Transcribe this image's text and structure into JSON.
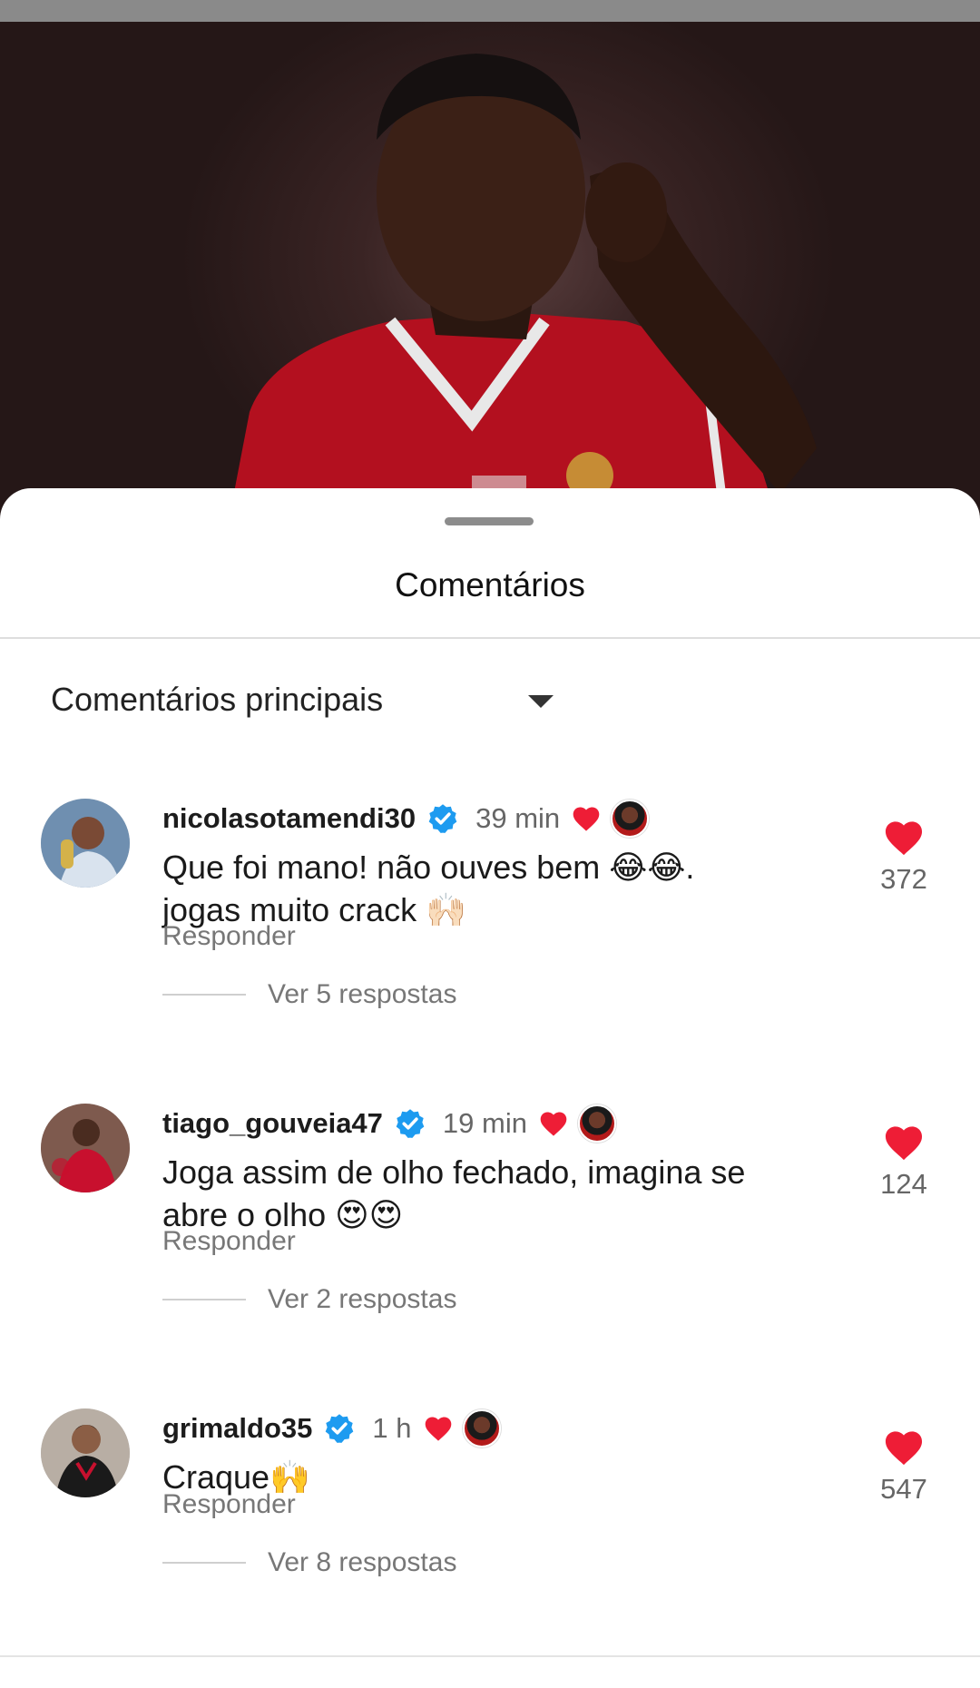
{
  "sheet": {
    "title": "Comentários",
    "sort_label": "Comentários principais"
  },
  "comments": [
    {
      "username": "nicolasotamendi30",
      "time": "39 min",
      "text": "Que foi mano!  não ouves bem 😂😂.\n jogas muito crack 🙌🏻",
      "reply_label": "Responder",
      "replies_label": "Ver 5 respostas",
      "likes": "372"
    },
    {
      "username": "tiago_gouveia47",
      "time": "19 min",
      "text": "Joga assim de olho fechado, imagina se abre o olho 😍😍",
      "reply_label": "Responder",
      "replies_label": "Ver 2 respostas",
      "likes": "124"
    },
    {
      "username": "grimaldo35",
      "time": "1 h",
      "text": "Craque🙌",
      "reply_label": "Responder",
      "replies_label": "Ver 8 respostas",
      "likes": "547"
    }
  ],
  "colors": {
    "heart": "#ee1d36",
    "verified": "#1d9bf0",
    "jersey": "#c8102e"
  }
}
